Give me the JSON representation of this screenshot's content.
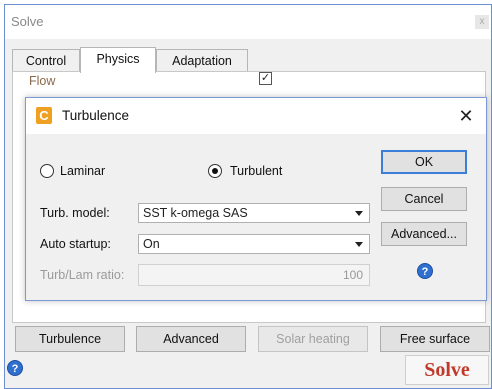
{
  "window": {
    "title": "Solve",
    "close_glyph": "x",
    "tabs": [
      {
        "label": "Control",
        "active": false
      },
      {
        "label": "Physics",
        "active": true
      },
      {
        "label": "Adaptation",
        "active": false
      }
    ],
    "physics": {
      "flow_label": "Flow",
      "flow_checked": true,
      "check_glyph": "✓"
    },
    "bottom_buttons": [
      {
        "label": "Turbulence",
        "enabled": true
      },
      {
        "label": "Advanced",
        "enabled": true
      },
      {
        "label": "Solar heating",
        "enabled": false
      },
      {
        "label": "Free surface",
        "enabled": true
      }
    ],
    "help_glyph": "?",
    "solve_label": "Solve",
    "solve_color": "#c0392b"
  },
  "dialog": {
    "title": "Turbulence",
    "icon": "app-logo-icon",
    "icon_glyph": "C",
    "close_glyph": "✕",
    "radios": [
      {
        "label": "Laminar",
        "selected": false
      },
      {
        "label": "Turbulent",
        "selected": true
      }
    ],
    "turb_model": {
      "label": "Turb. model:",
      "value": "SST k-omega SAS"
    },
    "auto_startup": {
      "label": "Auto startup:",
      "value": "On"
    },
    "ratio": {
      "label": "Turb/Lam ratio:",
      "value": "100",
      "enabled": false
    },
    "buttons": {
      "ok": "OK",
      "cancel": "Cancel",
      "advanced": "Advanced..."
    },
    "help_glyph": "?"
  }
}
